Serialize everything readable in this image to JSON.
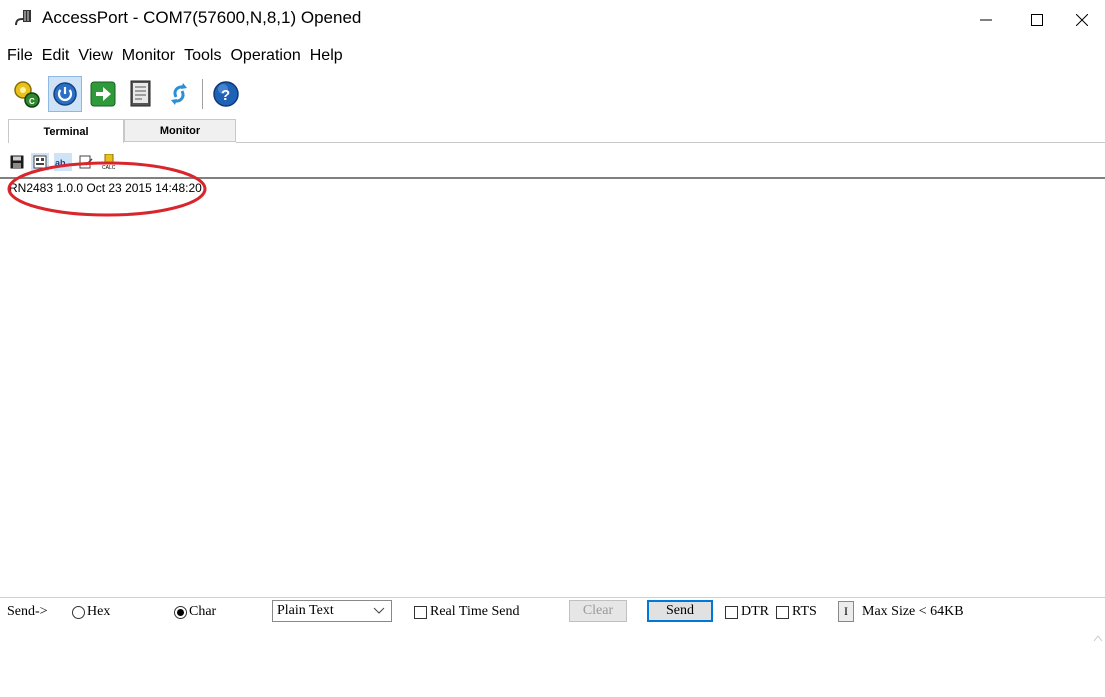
{
  "window": {
    "title": "AccessPort - COM7(57600,N,8,1) Opened",
    "controls": [
      "minimize-icon",
      "maximize-icon",
      "close-icon"
    ]
  },
  "menu": [
    "File",
    "Edit",
    "View",
    "Monitor",
    "Tools",
    "Operation",
    "Help"
  ],
  "toolbar": {
    "icons": [
      "settings-icon",
      "power-icon",
      "go-icon",
      "document-icon",
      "refresh-icon",
      "help-icon"
    ]
  },
  "tabs": [
    {
      "label": "Terminal",
      "active": true
    },
    {
      "label": "Monitor",
      "active": false
    }
  ],
  "terminal_toolbar": {
    "icons": [
      "save-icon",
      "hex-view-icon",
      "char-view-icon",
      "clear-screen-icon",
      "calc-icon"
    ]
  },
  "terminal": {
    "output": "RN2483 1.0.0 Oct 23 2015 14:48:20",
    "annotation_color": "#d9262c"
  },
  "sendbar": {
    "send_label": "Send->",
    "hex_label": "Hex",
    "char_label": "Char",
    "mode_selected": "Char",
    "format_value": "Plain Text",
    "realtime_label": "Real Time Send",
    "clear_label": "Clear",
    "send_button_label": "Send",
    "dtr_label": "DTR",
    "rts_label": "RTS",
    "mini_label": "I",
    "max_size_label": "Max Size < 64KB"
  },
  "colors": {
    "accent": "#0078d7",
    "tab_active": "#ffffff",
    "tab_inactive": "#f0f0f0"
  }
}
